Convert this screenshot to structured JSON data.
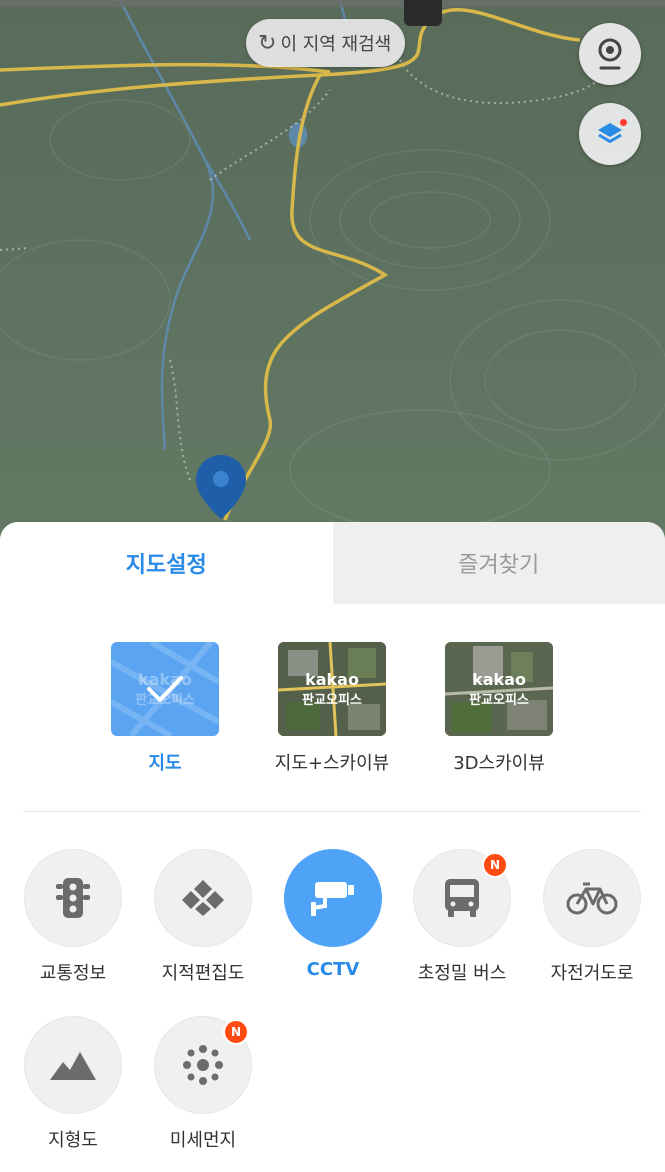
{
  "map": {
    "research_button": "이 지역 재검색",
    "research_icon": "refresh-icon"
  },
  "sheet": {
    "tabs": [
      {
        "label": "지도설정",
        "active": true
      },
      {
        "label": "즐겨찾기",
        "active": false
      }
    ],
    "map_types": [
      {
        "label": "지도",
        "selected": true,
        "thumb_line1": "kakao",
        "thumb_line2": "판교오피스"
      },
      {
        "label": "지도+스카이뷰",
        "selected": false,
        "thumb_line1": "kakao",
        "thumb_line2": "판교오피스"
      },
      {
        "label": "3D스카이뷰",
        "selected": false,
        "thumb_line1": "kakao",
        "thumb_line2": "판교오피스"
      }
    ],
    "layers": [
      {
        "label": "교통정보",
        "icon": "traffic-light-icon",
        "on": false,
        "badge": ""
      },
      {
        "label": "지적편집도",
        "icon": "cadastral-icon",
        "on": false,
        "badge": ""
      },
      {
        "label": "CCTV",
        "icon": "cctv-icon",
        "on": true,
        "badge": ""
      },
      {
        "label": "초정밀 버스",
        "icon": "bus-icon",
        "on": false,
        "badge": "N"
      },
      {
        "label": "자전거도로",
        "icon": "bicycle-icon",
        "on": false,
        "badge": ""
      },
      {
        "label": "지형도",
        "icon": "terrain-icon",
        "on": false,
        "badge": ""
      },
      {
        "label": "미세먼지",
        "icon": "fine-dust-icon",
        "on": false,
        "badge": "N"
      }
    ]
  },
  "colors": {
    "accent": "#2a8be6",
    "badge": "#ff4b12",
    "active_circle": "#4ea3f7"
  }
}
